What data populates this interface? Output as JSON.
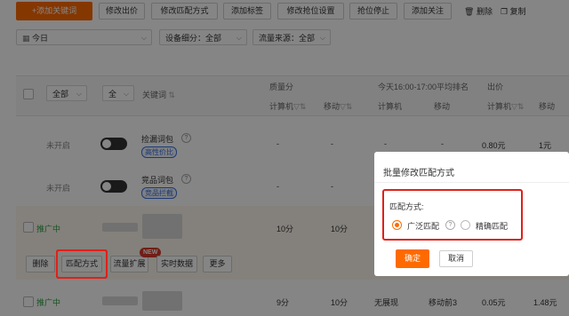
{
  "toolbar": {
    "add_keyword": "+添加关键词",
    "modify_bid": "修改出价",
    "modify_match": "修改匹配方式",
    "add_tag": "添加标签",
    "modify_rank": "修改抢位设置",
    "stop_rank": "抢位停止",
    "add_follow": "添加关注",
    "delete": "删除",
    "copy": "复制"
  },
  "filters": {
    "date": "今日",
    "device": "设备细分：全部",
    "traffic": "流量来源：全部"
  },
  "table": {
    "header": {
      "all_select_1": "全部",
      "all_select_2": "全",
      "keyword": "关键词",
      "quality_group": "质量分",
      "time_group": "今天16:00-17:00平均排名",
      "bid_group": "出价",
      "pc": "计算机",
      "mobile": "移动",
      "pc2": "计算机",
      "mobile2": "移动",
      "pc3": "计算机",
      "mobile3": "移动"
    },
    "rows": [
      {
        "status": "未开启",
        "name": "捡漏词包",
        "tag": "高性价比",
        "q1": "-",
        "q2": "-",
        "r1": "-",
        "r2": "-",
        "bid": "0.80元",
        "bid2": "1元"
      },
      {
        "status": "未开启",
        "name": "竞品词包",
        "tag": "竞品拦截",
        "q1": "-",
        "q2": "-",
        "r1": "-",
        "r2": "-",
        "bid": "-",
        "bid2": "-"
      },
      {
        "status": "推广中",
        "q1": "10分",
        "q2": "10分",
        "r1": "",
        "r2": "",
        "bid": "",
        "bid2": ""
      },
      {
        "status": "推广中",
        "q1": "9分",
        "q2": "10分",
        "r1": "无展现",
        "r2": "移动前3",
        "bid": "0.05元",
        "bid2": "1.48元"
      }
    ],
    "row_actions": {
      "delete": "删除",
      "match": "匹配方式",
      "traffic_expand": "流量扩展",
      "new_badge": "NEW",
      "realtime": "实时数据",
      "more": "更多"
    }
  },
  "dialog": {
    "title": "批量修改匹配方式",
    "label": "匹配方式:",
    "option_broad": "广泛匹配",
    "option_exact": "精确匹配",
    "selected": "广泛匹配",
    "confirm": "确定",
    "cancel": "取消"
  },
  "colors": {
    "accent": "#ff6a00",
    "highlight": "#e0201a",
    "green": "#2e9e3e",
    "link": "#3a6fd8"
  }
}
